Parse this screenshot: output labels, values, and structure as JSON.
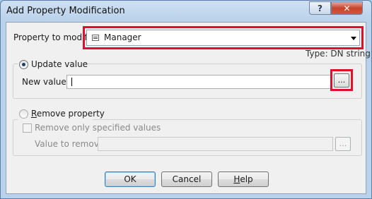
{
  "window": {
    "title": "Add Property Modification",
    "help_glyph": "?",
    "close_glyph": "✕"
  },
  "property": {
    "label": "Property to modify:",
    "value": "Manager",
    "type_hint": "Type: DN string",
    "icon": "list-icon"
  },
  "update": {
    "label": "Update value",
    "new_value_label": "New value:",
    "new_value": "",
    "browse_label": "..."
  },
  "remove": {
    "label_prefix": "",
    "label_mnemonic": "R",
    "label_rest": "emove property",
    "only_specified_label": "Remove only specified values",
    "value_to_remove_label": "Value to remove:",
    "value_to_remove": "",
    "browse_label": "..."
  },
  "buttons": {
    "ok": "OK",
    "cancel": "Cancel",
    "help_mnemonic": "H",
    "help_rest": "elp"
  },
  "colors": {
    "highlight": "#e0102a",
    "title_bg": "#b9d1ea",
    "client_bg": "#f0f0f0"
  }
}
